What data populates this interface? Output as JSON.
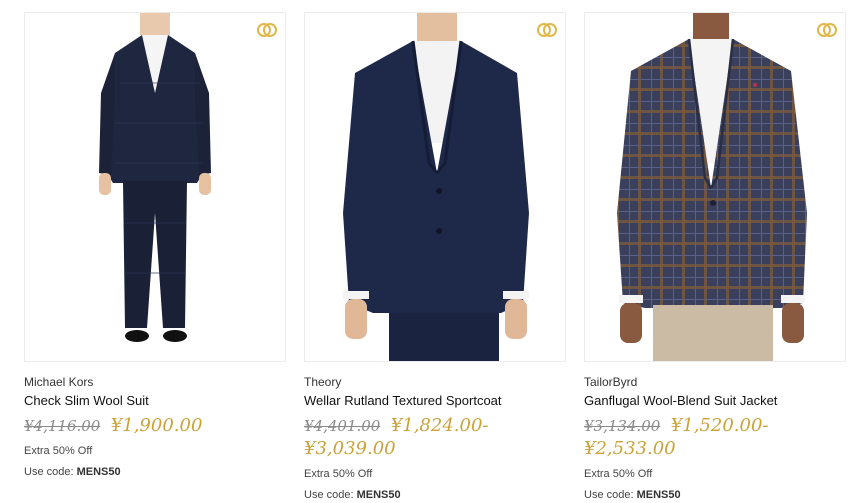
{
  "products": [
    {
      "brand": "Michael Kors",
      "name": "Check Slim Wool Suit",
      "original_price": "¥4,116.00",
      "sale_price": "¥1,900.00",
      "promo_text": "Extra 50% Off",
      "code_label": "Use code:",
      "code": "MENS50",
      "badge_icon": "rings-icon"
    },
    {
      "brand": "Theory",
      "name": "Wellar Rutland Textured Sportcoat",
      "original_price": "¥4,401.00",
      "sale_price": "¥1,824.00-\n¥3,039.00",
      "promo_text": "Extra 50% Off",
      "code_label": "Use code:",
      "code": "MENS50",
      "badge_icon": "rings-icon"
    },
    {
      "brand": "TailorByrd",
      "name": "Ganflugal Wool-Blend Suit Jacket",
      "original_price": "¥3,134.00",
      "sale_price": "¥1,520.00-¥2,533.00",
      "promo_text": "Extra 50% Off",
      "code_label": "Use code:",
      "code": "MENS50",
      "badge_icon": "rings-icon"
    }
  ],
  "colors": {
    "sale_price": "#c9a23a",
    "original_price": "#8a8a8a",
    "badge": "#e0b84a"
  }
}
